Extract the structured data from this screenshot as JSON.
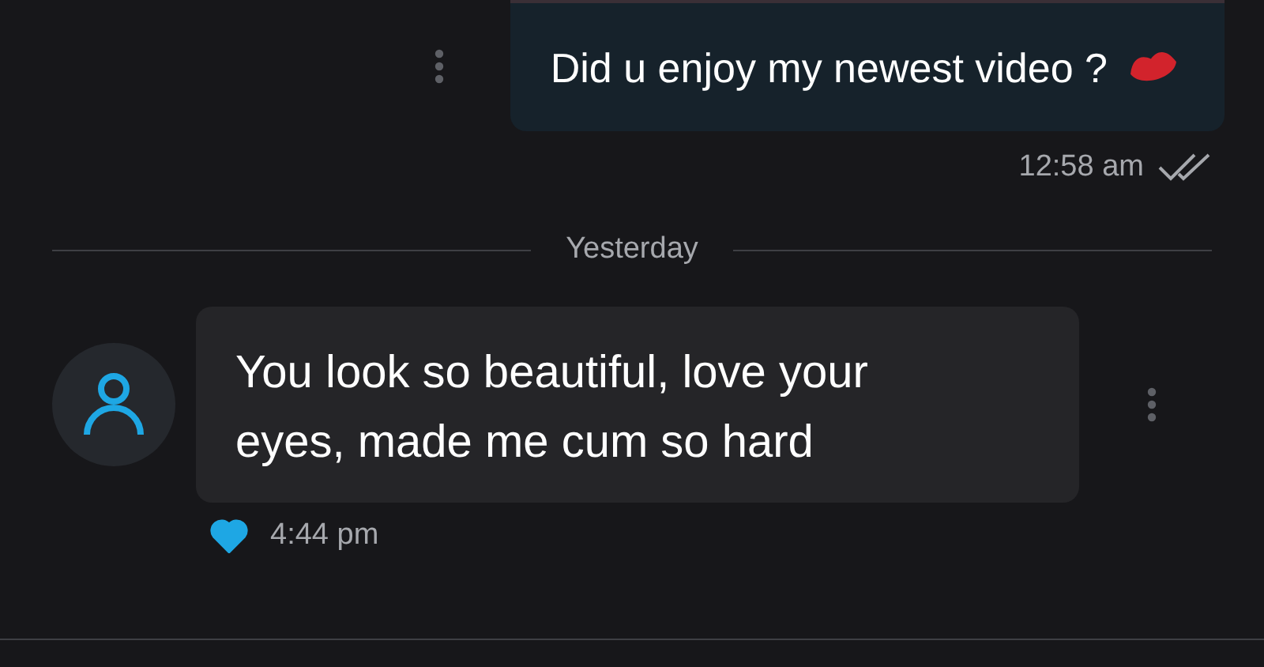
{
  "messages": [
    {
      "kind": "outgoing",
      "text": "Did u enjoy my newest video ?",
      "time": "12:58 am",
      "read": true
    },
    {
      "kind": "divider",
      "text": "Yesterday"
    },
    {
      "kind": "incoming",
      "text": "You look so beautiful, love your eyes, made me cum so hard",
      "time": "4:44 pm",
      "liked": true
    }
  ]
}
